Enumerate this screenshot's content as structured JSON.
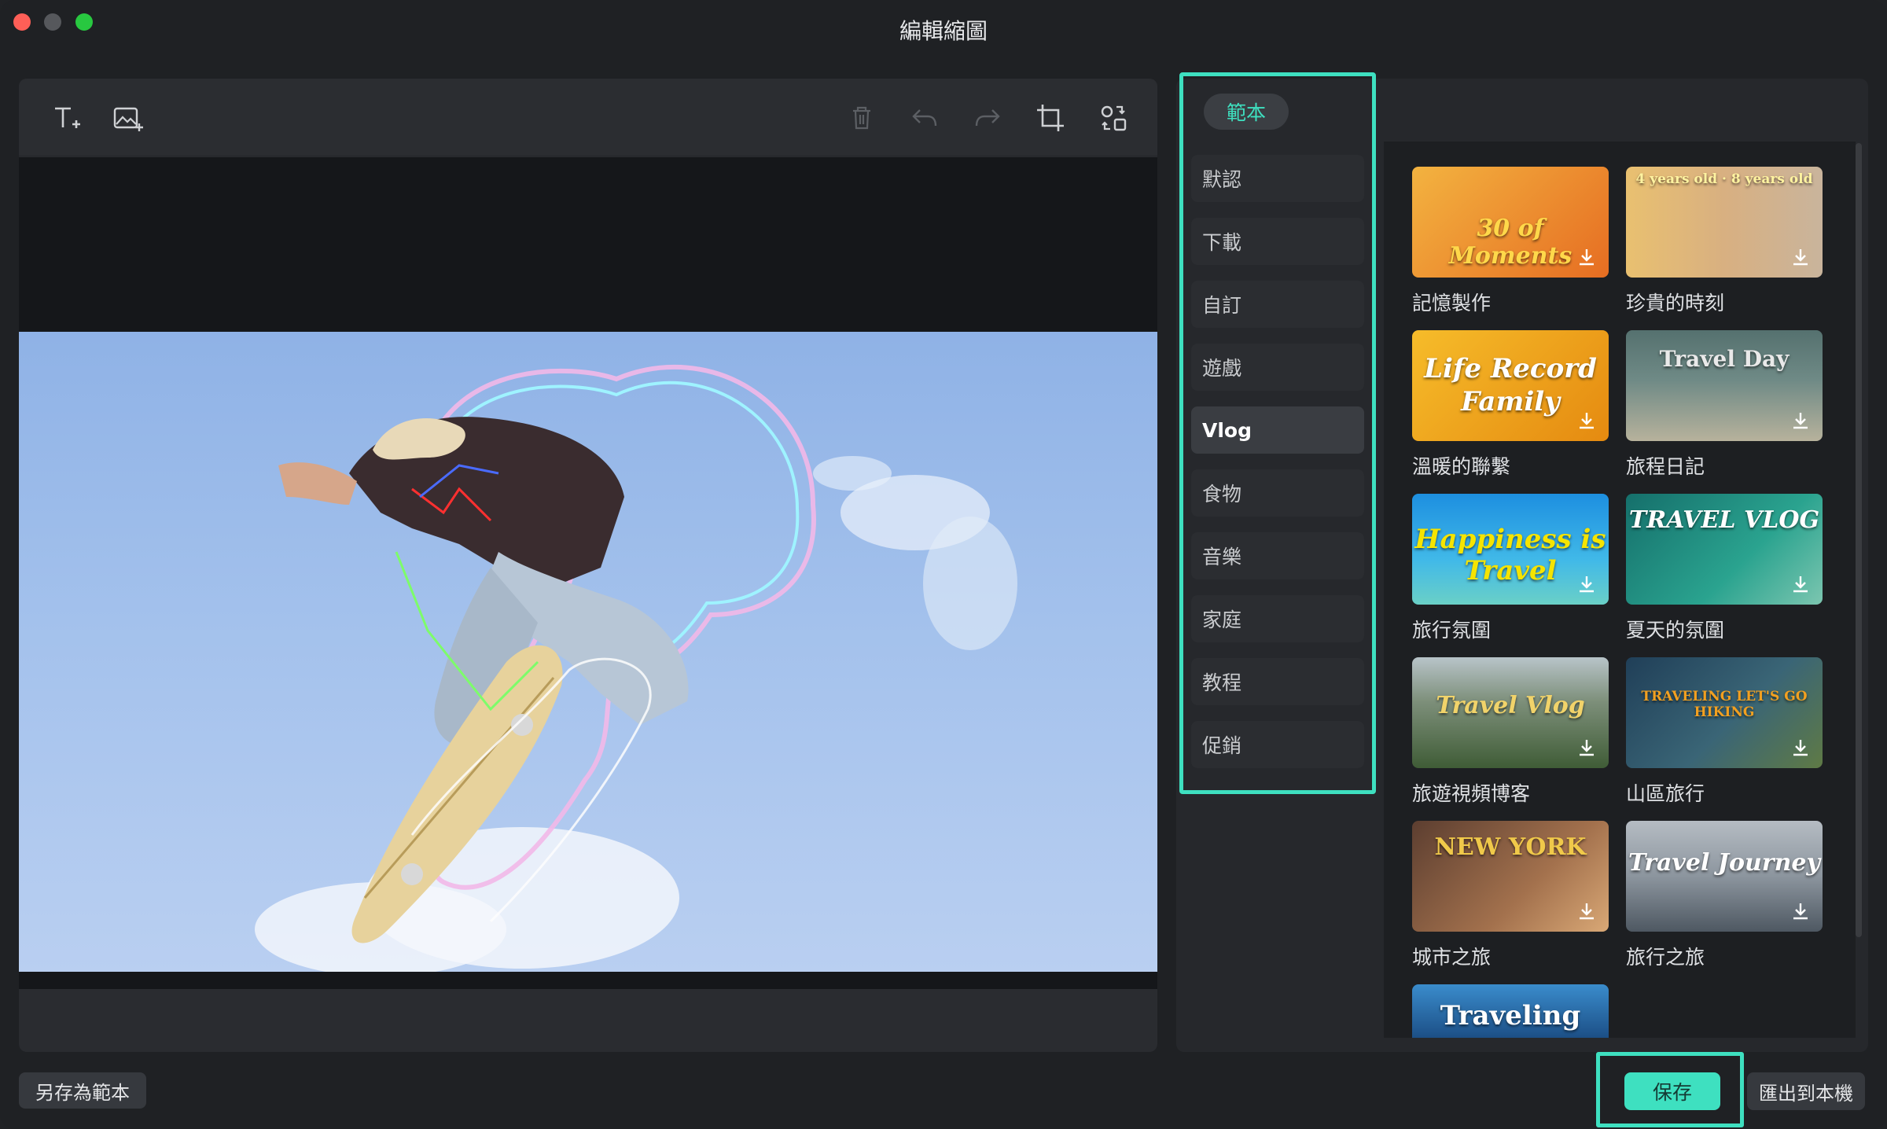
{
  "window": {
    "title": "編輯縮圖"
  },
  "toolbar": {
    "left_tools": [
      "text-add-icon",
      "image-add-icon"
    ],
    "right_tools": [
      "trash-icon",
      "undo-icon",
      "redo-icon",
      "crop-icon",
      "replace-icon"
    ]
  },
  "categories": {
    "header": "範本",
    "items": [
      {
        "label": "默認",
        "active": false
      },
      {
        "label": "下載",
        "active": false
      },
      {
        "label": "自訂",
        "active": false
      },
      {
        "label": "遊戲",
        "active": false
      },
      {
        "label": "Vlog",
        "active": true
      },
      {
        "label": "食物",
        "active": false
      },
      {
        "label": "音樂",
        "active": false
      },
      {
        "label": "家庭",
        "active": false
      },
      {
        "label": "教程",
        "active": false
      },
      {
        "label": "促銷",
        "active": false
      }
    ]
  },
  "templates": [
    {
      "caption": "記憶製作",
      "art_text": "30 of Moments",
      "colors": [
        "#f0a030",
        "#e8752a"
      ]
    },
    {
      "caption": "珍貴的時刻",
      "art_text": "4 years old · 8 years old",
      "colors": [
        "#e9b050",
        "#c7a57a"
      ]
    },
    {
      "caption": "溫暖的聯繫",
      "art_text": "Life Record Family",
      "colors": [
        "#f4b21c",
        "#e48d0f"
      ]
    },
    {
      "caption": "旅程日記",
      "art_text": "Travel Day",
      "colors": [
        "#4d6a6e",
        "#9aa69c"
      ]
    },
    {
      "caption": "旅行氛圍",
      "art_text": "Happiness is Travel",
      "colors": [
        "#1fa5e0",
        "#37c1d6"
      ]
    },
    {
      "caption": "夏天的氛圍",
      "art_text": "TRAVEL VLOG",
      "colors": [
        "#1a7f7a",
        "#2aa38f"
      ]
    },
    {
      "caption": "旅遊視頻博客",
      "art_text": "Travel Vlog",
      "colors": [
        "#7a8e73",
        "#43603a"
      ]
    },
    {
      "caption": "山區旅行",
      "art_text": "TRAVELING LET'S GO HIKING",
      "colors": [
        "#2a4a63",
        "#5a7b4d"
      ]
    },
    {
      "caption": "城市之旅",
      "art_text": "NEW YORK",
      "colors": [
        "#6b4a3a",
        "#c18b5f"
      ]
    },
    {
      "caption": "旅行之旅",
      "art_text": "Travel Journey",
      "colors": [
        "#9ea5ad",
        "#5a646e"
      ]
    },
    {
      "caption": "",
      "art_text": "Traveling",
      "colors": [
        "#2e78b8",
        "#1c4f86"
      ]
    }
  ],
  "buttons": {
    "save_as_template": "另存為範本",
    "save": "保存",
    "export": "匯出到本機"
  },
  "accent_color": "#3ee0c0"
}
